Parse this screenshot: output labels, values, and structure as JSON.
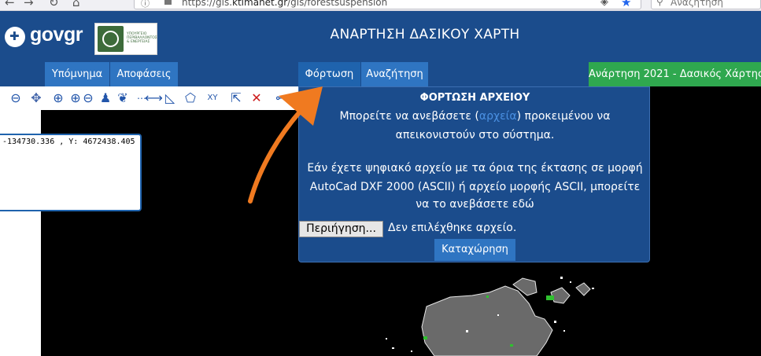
{
  "browser": {
    "url_prefix": "https://gis.",
    "url_host": "ktimanet.gr",
    "url_path": "/gis/forestsuspension",
    "search_placeholder": "Αναζήτηση"
  },
  "header": {
    "logo_text": "govgr",
    "ministry_text": "ΥΠΟΥΡΓΕΙΟ ΠΕΡΙΒΑΛΛΟΝΤΟΣ & ΕΝΕΡΓΕΙΑΣ",
    "title": "ΑΝΑΡΤΗΣΗ ΔΑΣΙΚΟΥ ΧΑΡΤΗ"
  },
  "nav": {
    "legend": "Υπόμνημα",
    "decisions": "Αποφάσεις",
    "upload": "Φόρτωση",
    "search": "Αναζήτηση",
    "posting": "Ανάρτηση 2021 - Δασικός Χάρτης"
  },
  "coords": {
    "text": "-134730.336 , Y: 4672438.405"
  },
  "upload_panel": {
    "title": "ΦΟΡΤΩΣΗ ΑΡΧΕΙΟΥ",
    "line1_pre": "Μπορείτε να ανεβάσετε (",
    "line1_link": "αρχεία",
    "line1_post": ") προκειμένου να",
    "line2": "απεικονιστούν στο σύστημα.",
    "line3": "Εάν έχετε ψηφιακό αρχείο με τα όρια της έκτασης σε μορφή",
    "line4": "AutoCad DXF 2000 (ASCII) ή αρχείο μορφής ASCII, μπορείτε",
    "line5": "να το ανεβάσετε εδώ",
    "browse_label": "Περιήγηση...",
    "no_file": "Δεν επιλέχθηκε αρχείο.",
    "submit_label": "Καταχώρηση"
  },
  "colors": {
    "header_blue": "#1b4c8c",
    "tab_blue": "#2f75c2",
    "tab_green": "#2fa84f",
    "annotation_orange": "#f07a20"
  }
}
